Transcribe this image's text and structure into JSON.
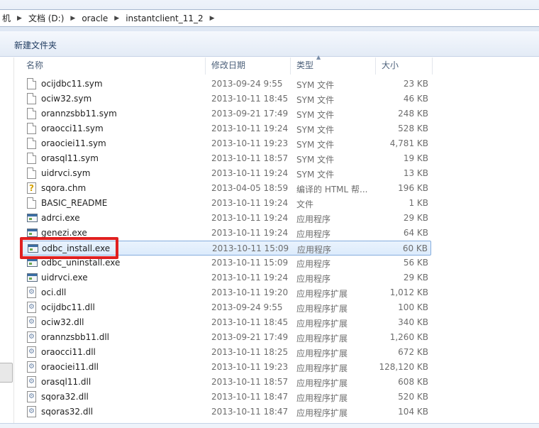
{
  "address": {
    "crumbs": [
      "机",
      "文档 (D:)",
      "oracle",
      "instantclient_11_2"
    ]
  },
  "toolbar": {
    "new_folder_label": "新建文件夹"
  },
  "columns": {
    "name": "名称",
    "modified": "修改日期",
    "type": "类型",
    "size": "大小"
  },
  "files": [
    {
      "name": "ocijdbc11.sym",
      "modified": "2013-09-24 9:55",
      "type": "SYM 文件",
      "size": "23 KB",
      "icon": "document-icon"
    },
    {
      "name": "ociw32.sym",
      "modified": "2013-10-11 18:45",
      "type": "SYM 文件",
      "size": "46 KB",
      "icon": "document-icon"
    },
    {
      "name": "orannzsbb11.sym",
      "modified": "2013-09-21 17:49",
      "type": "SYM 文件",
      "size": "248 KB",
      "icon": "document-icon"
    },
    {
      "name": "oraocci11.sym",
      "modified": "2013-10-11 19:24",
      "type": "SYM 文件",
      "size": "528 KB",
      "icon": "document-icon"
    },
    {
      "name": "oraociei11.sym",
      "modified": "2013-10-11 19:23",
      "type": "SYM 文件",
      "size": "4,781 KB",
      "icon": "document-icon"
    },
    {
      "name": "orasql11.sym",
      "modified": "2013-10-11 18:57",
      "type": "SYM 文件",
      "size": "19 KB",
      "icon": "document-icon"
    },
    {
      "name": "uidrvci.sym",
      "modified": "2013-10-11 19:24",
      "type": "SYM 文件",
      "size": "13 KB",
      "icon": "document-icon"
    },
    {
      "name": "sqora.chm",
      "modified": "2013-04-05 18:59",
      "type": "编译的 HTML 帮...",
      "size": "196 KB",
      "icon": "help-file-icon"
    },
    {
      "name": "BASIC_README",
      "modified": "2013-10-11 19:24",
      "type": "文件",
      "size": "1 KB",
      "icon": "document-icon"
    },
    {
      "name": "adrci.exe",
      "modified": "2013-10-11 19:24",
      "type": "应用程序",
      "size": "29 KB",
      "icon": "application-icon"
    },
    {
      "name": "genezi.exe",
      "modified": "2013-10-11 19:24",
      "type": "应用程序",
      "size": "64 KB",
      "icon": "application-icon"
    },
    {
      "name": "odbc_install.exe",
      "modified": "2013-10-11 15:09",
      "type": "应用程序",
      "size": "60 KB",
      "icon": "application-icon"
    },
    {
      "name": "odbc_uninstall.exe",
      "modified": "2013-10-11 15:09",
      "type": "应用程序",
      "size": "56 KB",
      "icon": "application-icon"
    },
    {
      "name": "uidrvci.exe",
      "modified": "2013-10-11 19:24",
      "type": "应用程序",
      "size": "29 KB",
      "icon": "application-icon"
    },
    {
      "name": "oci.dll",
      "modified": "2013-10-11 19:20",
      "type": "应用程序扩展",
      "size": "1,012 KB",
      "icon": "dll-icon"
    },
    {
      "name": "ocijdbc11.dll",
      "modified": "2013-09-24 9:55",
      "type": "应用程序扩展",
      "size": "100 KB",
      "icon": "dll-icon"
    },
    {
      "name": "ociw32.dll",
      "modified": "2013-10-11 18:45",
      "type": "应用程序扩展",
      "size": "340 KB",
      "icon": "dll-icon"
    },
    {
      "name": "orannzsbb11.dll",
      "modified": "2013-09-21 17:49",
      "type": "应用程序扩展",
      "size": "1,260 KB",
      "icon": "dll-icon"
    },
    {
      "name": "oraocci11.dll",
      "modified": "2013-10-11 18:25",
      "type": "应用程序扩展",
      "size": "672 KB",
      "icon": "dll-icon"
    },
    {
      "name": "oraociei11.dll",
      "modified": "2013-10-11 19:23",
      "type": "应用程序扩展",
      "size": "128,120 KB",
      "icon": "dll-icon"
    },
    {
      "name": "orasql11.dll",
      "modified": "2013-10-11 18:57",
      "type": "应用程序扩展",
      "size": "608 KB",
      "icon": "dll-icon"
    },
    {
      "name": "sqora32.dll",
      "modified": "2013-10-11 18:47",
      "type": "应用程序扩展",
      "size": "520 KB",
      "icon": "dll-icon"
    },
    {
      "name": "sqoras32.dll",
      "modified": "2013-10-11 18:47",
      "type": "应用程序扩展",
      "size": "104 KB",
      "icon": "dll-icon"
    }
  ],
  "selected_file": "odbc_install.exe",
  "colors": {
    "highlight_box": "#e02020",
    "selection_border": "#84acdd",
    "selection_fill": "#dcebfc"
  }
}
